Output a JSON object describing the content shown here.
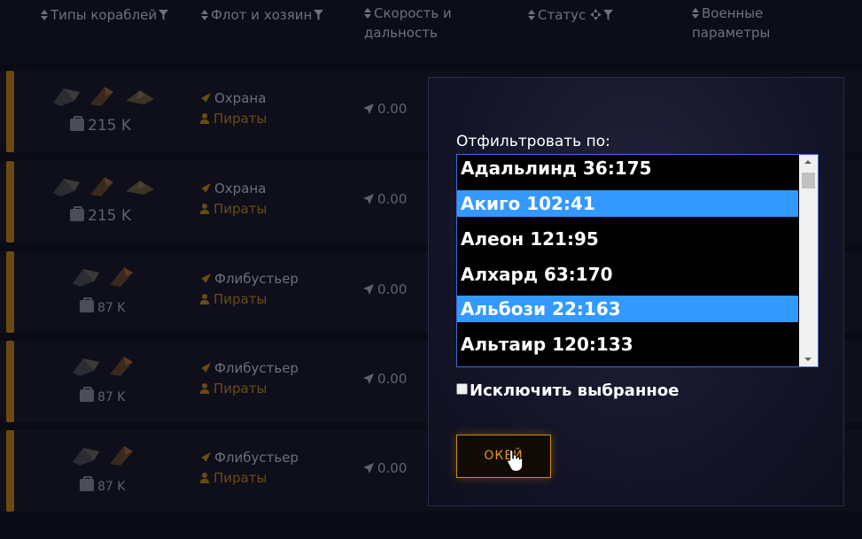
{
  "header": {
    "col_ship_types": "Типы кораблей",
    "col_fleet_owner": "Флот и хозяин",
    "col_speed_range_l1": "Скорость и",
    "col_speed_range_l2": "дальность",
    "col_status": "Статус",
    "col_military_l1": "Военные",
    "col_military_l2": "параметры"
  },
  "rows": [
    {
      "cargo": "215 K",
      "fleet": "Охрана",
      "owner": "Пираты",
      "speed": "0.00"
    },
    {
      "cargo": "215 K",
      "fleet": "Охрана",
      "owner": "Пираты",
      "speed": "0.00"
    },
    {
      "cargo": "87 K",
      "fleet": "Флибустьер",
      "owner": "Пираты",
      "speed": "0.00"
    },
    {
      "cargo": "87 K",
      "fleet": "Флибустьер",
      "owner": "Пираты",
      "speed": "0.00"
    },
    {
      "cargo": "87 K",
      "fleet": "Флибустьер",
      "owner": "Пираты",
      "speed": "0.00"
    }
  ],
  "filter_modal": {
    "label": "Отфильтровать по:",
    "options": [
      {
        "text": "Адальлинд 36:175",
        "selected": false
      },
      {
        "text": "Акиго 102:41",
        "selected": true
      },
      {
        "text": "Алеон 121:95",
        "selected": false
      },
      {
        "text": "Алхард 63:170",
        "selected": false
      },
      {
        "text": "Альбози 22:163",
        "selected": true
      },
      {
        "text": "Альтаир 120:133",
        "selected": false
      }
    ],
    "exclude_label": "Исключить выбранное",
    "ok_label": "ОКЕЙ"
  },
  "colors": {
    "accent": "#e8931a",
    "selection": "#3399ff",
    "owner": "#6a4b14"
  },
  "icons": {
    "sort": "sort-icon",
    "filter": "funnel-icon",
    "cargo": "bag-icon",
    "fleet": "rocket-icon",
    "owner": "user-icon",
    "speed": "arrow-icon"
  }
}
